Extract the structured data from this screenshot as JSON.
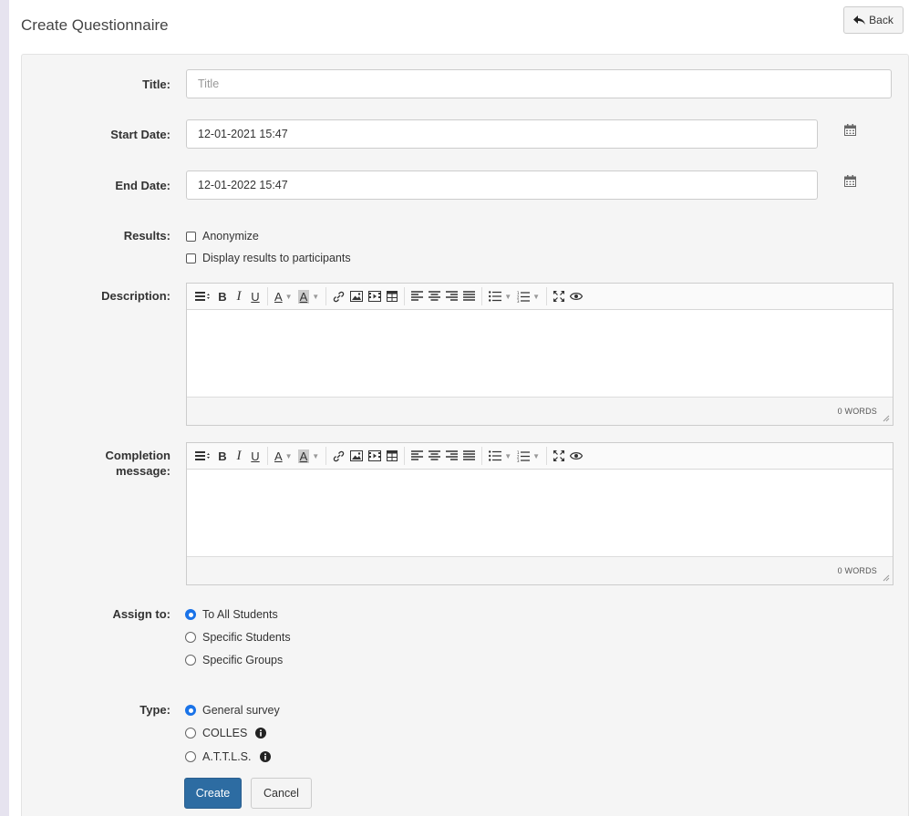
{
  "page": {
    "title": "Create Questionnaire",
    "back_label": "Back"
  },
  "form": {
    "title": {
      "label": "Title:",
      "placeholder": "Title",
      "value": ""
    },
    "start_date": {
      "label": "Start Date:",
      "value": "12-01-2021 15:47"
    },
    "end_date": {
      "label": "End Date:",
      "value": "12-01-2022 15:47"
    },
    "results": {
      "label": "Results:",
      "options": [
        {
          "label": "Anonymize",
          "checked": false
        },
        {
          "label": "Display results to participants",
          "checked": false
        }
      ]
    },
    "description": {
      "label": "Description:",
      "word_count": "0 WORDS"
    },
    "completion": {
      "label_line1": "Completion",
      "label_line2": "message:",
      "word_count": "0 WORDS"
    },
    "assign_to": {
      "label": "Assign to:",
      "options": [
        {
          "label": "To All Students",
          "checked": true
        },
        {
          "label": "Specific Students",
          "checked": false
        },
        {
          "label": "Specific Groups",
          "checked": false
        }
      ]
    },
    "type": {
      "label": "Type:",
      "options": [
        {
          "label": "General survey",
          "checked": true,
          "info": false
        },
        {
          "label": "COLLES",
          "checked": false,
          "info": true
        },
        {
          "label": "A.T.T.L.S.",
          "checked": false,
          "info": true
        }
      ]
    },
    "create_label": "Create",
    "cancel_label": "Cancel"
  },
  "colors": {
    "primary": "#2d6ca2",
    "radio_checked": "#1a73e8",
    "panel_bg": "#f5f5f5",
    "outer_bg": "#e6e3ef"
  },
  "icons": {
    "back": "reply-arrow-icon",
    "calendar": "calendar-icon",
    "info": "info-circle-icon"
  }
}
